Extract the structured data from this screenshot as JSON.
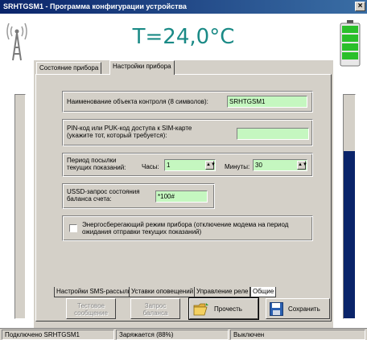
{
  "window": {
    "title": "SRHTGSM1 - Программа конфигурации устройства",
    "close_glyph": "×"
  },
  "temperature": "T=24,0°C",
  "battery": {
    "charge_percent": 88,
    "color": "#2bbf2b"
  },
  "signal_level_percent": 75,
  "tabs": [
    {
      "label": "Состояние прибора"
    },
    {
      "label": "Настройки прибора"
    }
  ],
  "form": {
    "object_name": {
      "label": "Наименование объекта контроля (8 символов):",
      "value": "SRHTGSM1"
    },
    "pin": {
      "label_line1": "PIN-код или PUK-код доступа к SIM-карте",
      "label_line2": "(укажите тот, который требуется):",
      "value": ""
    },
    "period": {
      "label_line1": "Период посылки",
      "label_line2": "текущих показаний:",
      "hours_label": "Часы:",
      "hours_value": "1",
      "minutes_label": "Минуты:",
      "minutes_value": "30"
    },
    "ussd": {
      "label_line1": "USSD-запрос состояния",
      "label_line2": "баланса счета:",
      "value": "*100#"
    },
    "energy": {
      "label_line1": "Энергосберегающий режим прибора (отключение модема на период",
      "label_line2": "ожидания отправки текущих показаний)",
      "checked": false
    }
  },
  "subtabs": [
    {
      "label": "Настройки SMS-рассылки"
    },
    {
      "label": "Уставки оповещений"
    },
    {
      "label": "Управление реле"
    },
    {
      "label": "Общие"
    }
  ],
  "buttons": {
    "test_line1": "Тестовое",
    "test_line2": "сообщение",
    "balance_line1": "Запрос",
    "balance_line2": "баланса",
    "read": "Прочесть",
    "save": "Сохранить"
  },
  "status": {
    "connection": "Подключено SRHTGSM1",
    "charging": "Заряжается (88%)",
    "power": "Выключен"
  },
  "colors": {
    "title_gradient_start": "#0a246a",
    "title_gradient_end": "#3a6ea5",
    "temperature": "#1a8a86",
    "input_bg": "#c5f7c0",
    "signal_bar": "#0a246a"
  },
  "icons": {
    "antenna": "antenna-icon",
    "battery": "battery-icon",
    "folder": "folder-open-icon",
    "save": "floppy-disk-icon",
    "spin": "spin-arrows-icon"
  }
}
